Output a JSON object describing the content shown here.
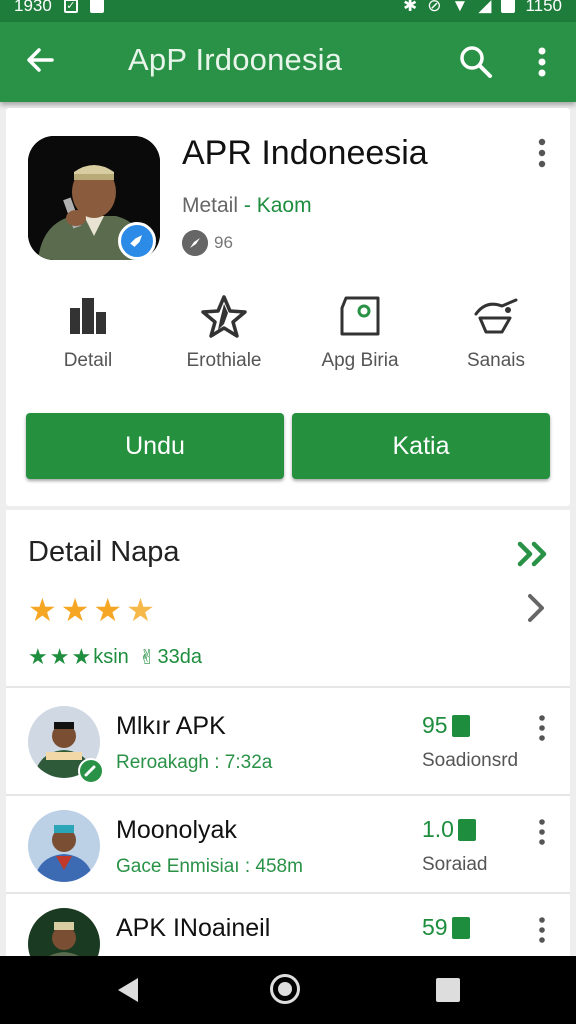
{
  "status_bar": {
    "time_left": "1930",
    "time_right": "1150"
  },
  "app_bar": {
    "title": "ApP Irdoonesia",
    "back_icon": "arrow-left-icon",
    "search_icon": "search-icon",
    "overflow_icon": "more-vert-icon"
  },
  "app": {
    "name": "APR Indoneesia",
    "developer_prefix": "Metail",
    "developer_sep": " - ",
    "developer_name": "Kaom",
    "meta": "96",
    "verified_icon": "verified-icon"
  },
  "actions": [
    {
      "label": "Detail",
      "icon": "building-icon"
    },
    {
      "label": "Erothiale",
      "icon": "star-outline-icon"
    },
    {
      "label": "Apg Biria",
      "icon": "tag-icon"
    },
    {
      "label": "Sanais",
      "icon": "cart-icon"
    }
  ],
  "buttons": {
    "primary": "Undu",
    "secondary": "Katia"
  },
  "detail": {
    "title": "Detail Napa",
    "stars": 3.5,
    "rating_text": "ksin",
    "rating_count": "33da"
  },
  "list": [
    {
      "title": "Mlkır APK",
      "subtitle": "Reroakagh : 7:32a",
      "number": "95",
      "caption": "Soadionsrd"
    },
    {
      "title": "Moonolyak",
      "subtitle": "Gace Enmisiaı : 458m",
      "number": "1.0",
      "caption": "Soraiad"
    },
    {
      "title": "APK INoaineil",
      "subtitle": "",
      "number": "59",
      "caption": ""
    }
  ],
  "colors": {
    "primary": "#2a9247",
    "dark": "#1e7d3a",
    "star": "#f5a623"
  }
}
